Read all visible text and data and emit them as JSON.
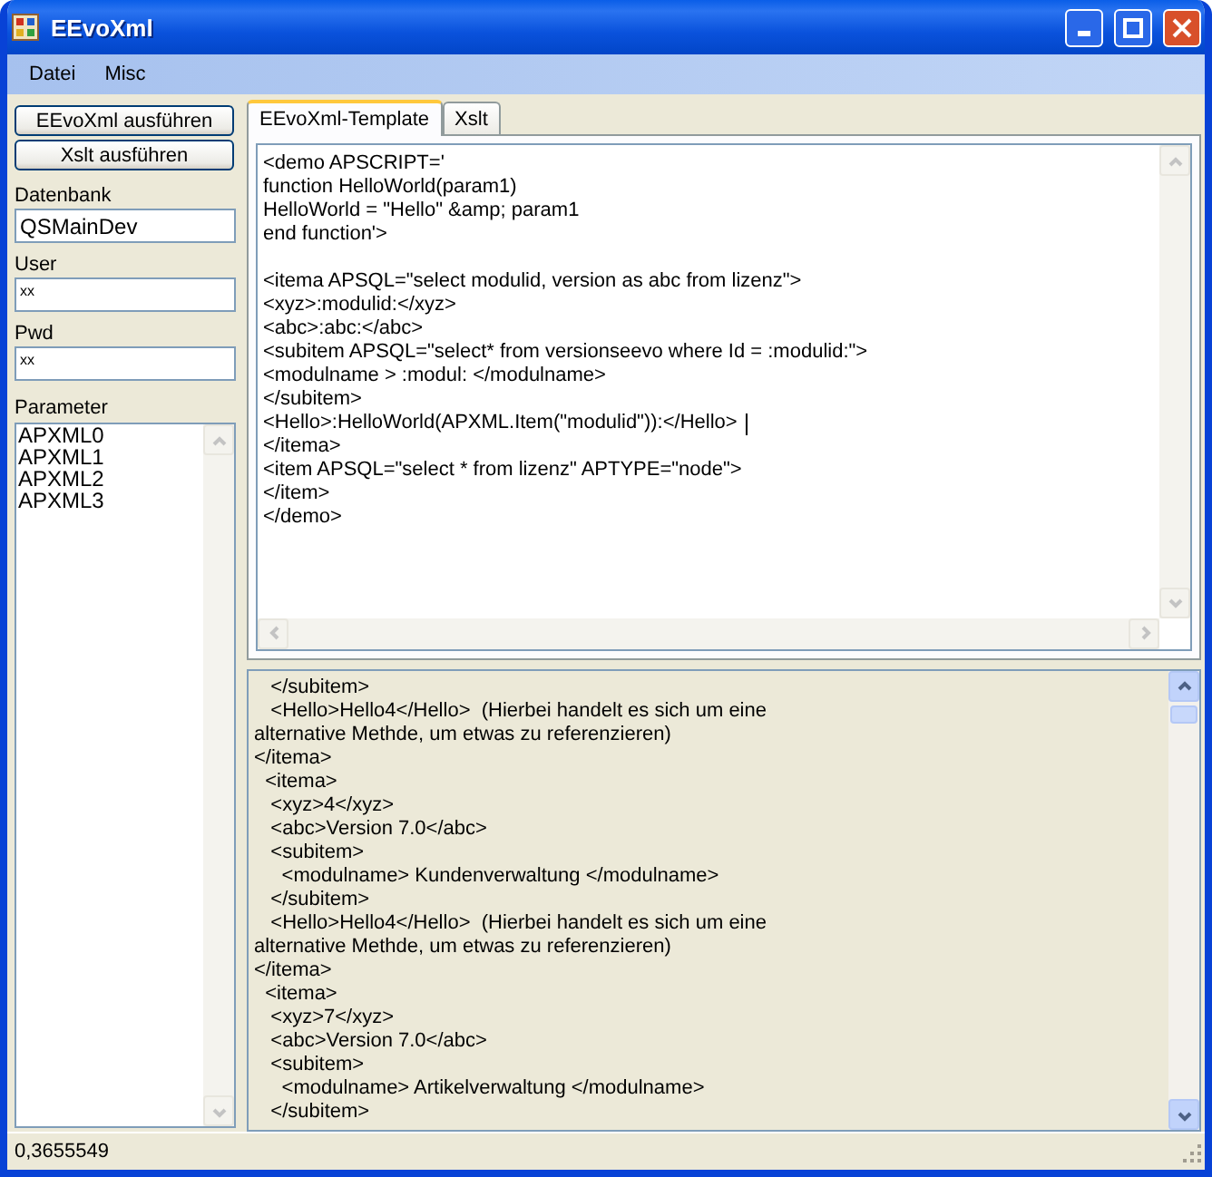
{
  "window": {
    "title": "EEvoXml"
  },
  "menu": [
    "Datei",
    "Misc"
  ],
  "buttons": [
    "EEvoXml ausführen",
    "Xslt ausführen"
  ],
  "fields": [
    {
      "label": "Datenbank",
      "value": "QSMainDev"
    },
    {
      "label": "User",
      "value": "xx"
    },
    {
      "label": "Pwd",
      "value": "xx"
    }
  ],
  "parameter": {
    "label": "Parameter",
    "items": [
      "APXML0",
      "APXML1",
      "APXML2",
      "APXML3"
    ]
  },
  "tabs": [
    {
      "label": "EEvoXml-Template",
      "selected": true
    },
    {
      "label": "Xslt",
      "selected": false
    }
  ],
  "editor": {
    "blocks": [
      [
        {
          "text": "<demo APSCRIPT='",
          "cursor": false
        },
        {
          "text": "function HelloWorld(param1)",
          "cursor": false
        },
        {
          "text": "HelloWorld = \"Hello\" &amp; param1",
          "cursor": false
        },
        {
          "text": "end function'>",
          "cursor": false
        }
      ],
      [
        {
          "text": "<itema APSQL=\"select modulid, version as abc from lizenz\">",
          "cursor": false
        },
        {
          "text": "<xyz>:modulid:</xyz>",
          "cursor": false
        },
        {
          "text": "<abc>:abc:</abc>",
          "cursor": false
        },
        {
          "text": "<subitem APSQL=\"select* from versionseevo where Id = :modulid:\">",
          "cursor": false
        },
        {
          "text": "<modulname > :modul: </modulname>",
          "cursor": false
        },
        {
          "text": "</subitem>",
          "cursor": false
        },
        {
          "text": "<Hello>:HelloWorld(APXML.Item(\"modulid\")):</Hello> ",
          "cursor": true
        },
        {
          "text": "</itema>",
          "cursor": false
        },
        {
          "text": "<item APSQL=\"select * from lizenz\" APTYPE=\"node\">",
          "cursor": false
        },
        {
          "text": "</item>",
          "cursor": false
        },
        {
          "text": "</demo>",
          "cursor": false
        }
      ]
    ]
  },
  "output": {
    "lines": [
      "   </subitem>",
      "   <Hello>Hello4</Hello>  (Hierbei handelt es sich um eine",
      "alternative Methde, um etwas zu referenzieren)",
      "</itema>",
      "  <itema>",
      "   <xyz>4</xyz>",
      "   <abc>Version 7.0</abc>",
      "   <subitem>",
      "     <modulname> Kundenverwaltung </modulname>",
      "   </subitem>",
      "   <Hello>Hello4</Hello>  (Hierbei handelt es sich um eine",
      "alternative Methde, um etwas zu referenzieren)",
      "</itema>",
      "  <itema>",
      "   <xyz>7</xyz>",
      "   <abc>Version 7.0</abc>",
      "   <subitem>",
      "     <modulname> Artikelverwaltung </modulname>",
      "   </subitem>"
    ]
  },
  "status_bar": {
    "text": "0,3655549"
  }
}
